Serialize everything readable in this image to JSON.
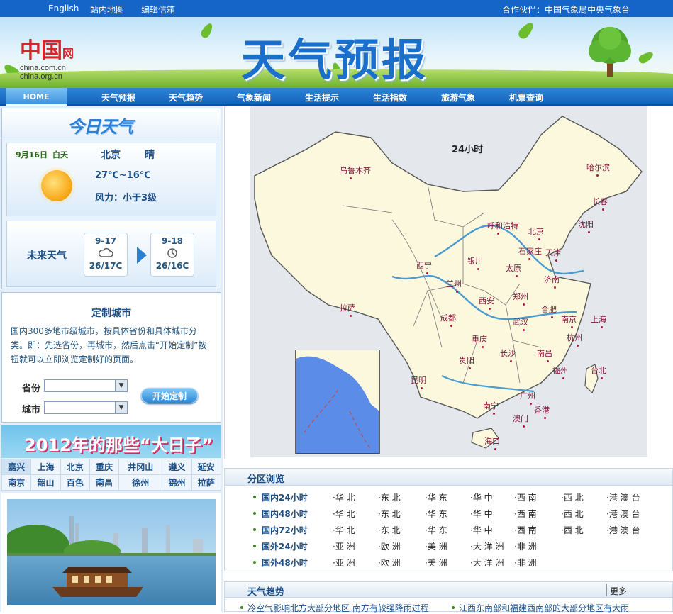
{
  "topbar": {
    "links": [
      "English",
      "站内地图",
      "编辑信箱"
    ],
    "partner": "合作伙伴：中国气象局中央气象台"
  },
  "banner": {
    "logo_main": "中国",
    "logo_wang": "网",
    "logo_domain1": "china.com.cn",
    "logo_domain2": "china.org.cn",
    "title": "天气预报"
  },
  "nav": {
    "home": "HOME",
    "items": [
      "天气预报",
      "天气趋势",
      "气象新闻",
      "生活提示",
      "生活指数",
      "旅游气象",
      "机票查询"
    ]
  },
  "today": {
    "header": "今日天气",
    "date": "9月16日",
    "period": "白天",
    "city": "北京",
    "condition": "晴",
    "temp": "27℃~16℃",
    "wind": "风力：小于3级",
    "icon": "sun-icon"
  },
  "future": {
    "label": "未来天气",
    "days": [
      {
        "date": "9-17",
        "icon": "cloud-icon",
        "temp": "26/17C"
      },
      {
        "date": "9-18",
        "icon": "clock-icon",
        "temp": "26/16C"
      }
    ]
  },
  "custom": {
    "title": "定制城市",
    "desc": "国内300多地市级城市，按具体省份和具体城市分类。即：先选省份，再城市，然后点击“开始定制”按钮就可以立即浏览定制好的页面。",
    "province_label": "省份",
    "city_label": "城市",
    "button": "开始定制"
  },
  "bigdays": {
    "banner": "2012年的那些“大日子”",
    "cities": [
      [
        "嘉兴",
        "上海",
        "北京",
        "重庆",
        "井冈山",
        "遵义",
        "延安"
      ],
      [
        "南京",
        "韶山",
        "百色",
        "南昌",
        "徐州",
        "锦州",
        "拉萨"
      ]
    ]
  },
  "map": {
    "label": "24小时",
    "cities": [
      "乌鲁木齐",
      "哈尔滨",
      "长春",
      "沈阳",
      "呼和浩特",
      "北京",
      "天津",
      "石家庄",
      "银川",
      "西宁",
      "太原",
      "济南",
      "兰州",
      "郑州",
      "西安",
      "合肥",
      "南京",
      "上海",
      "拉萨",
      "成都",
      "武汉",
      "杭州",
      "重庆",
      "长沙",
      "南昌",
      "贵阳",
      "福州",
      "台北",
      "昆明",
      "广州",
      "南宁",
      "香港",
      "澳门",
      "海口"
    ]
  },
  "region": {
    "title": "分区浏览",
    "rows": [
      {
        "label": "国内24小时",
        "cols": [
          "·华 北",
          "·东 北",
          "·华 东",
          "·华 中",
          "·西 南",
          "·西 北",
          "·港 澳 台"
        ]
      },
      {
        "label": "国内48小时",
        "cols": [
          "·华 北",
          "·东 北",
          "·华 东",
          "·华 中",
          "·西 南",
          "·西 北",
          "·港 澳 台"
        ]
      },
      {
        "label": "国内72小时",
        "cols": [
          "·华 北",
          "·东 北",
          "·华 东",
          "·华 中",
          "·西 南",
          "·西 北",
          "·港 澳 台"
        ]
      },
      {
        "label": "国外24小时",
        "cols": [
          "·亚 洲",
          "·欧 洲",
          "·美 洲",
          "·大 洋 洲",
          "·非 洲"
        ]
      },
      {
        "label": "国外48小时",
        "cols": [
          "·亚 洲",
          "·欧 洲",
          "·美 洲",
          "·大 洋 洲",
          "·非 洲"
        ]
      }
    ]
  },
  "trend": {
    "title": "天气趋势",
    "more": "更多",
    "news": [
      "冷空气影响北方大部分地区 南方有较强降雨过程",
      "江西东南部和福建西南部的大部分地区有大雨"
    ]
  }
}
